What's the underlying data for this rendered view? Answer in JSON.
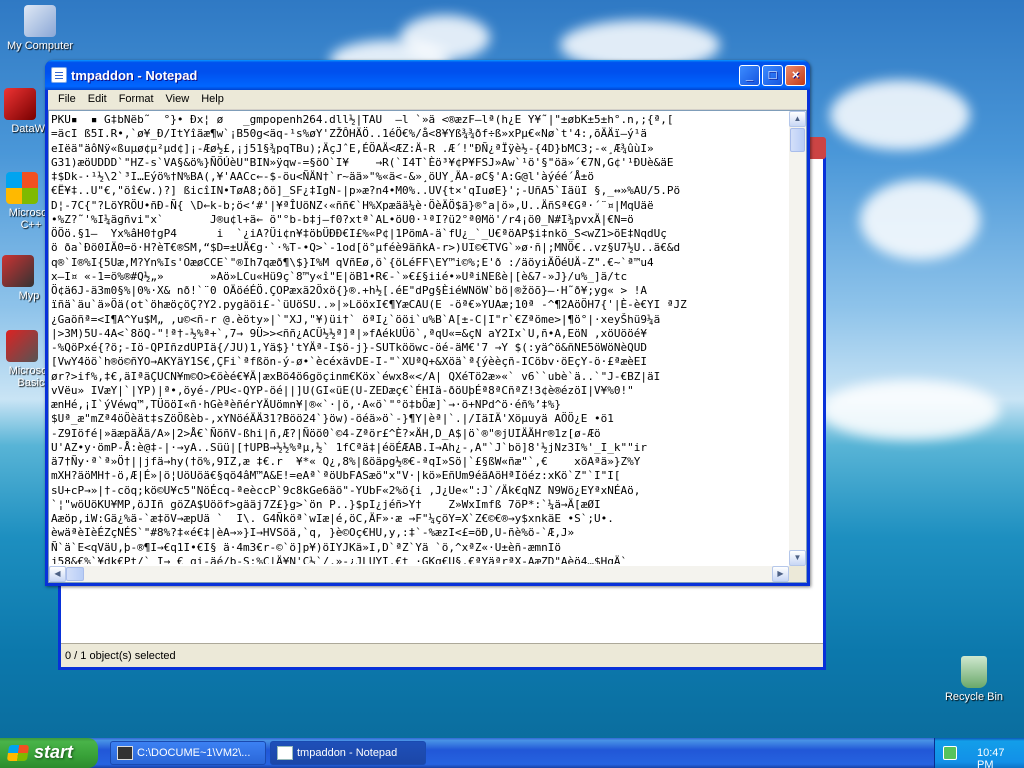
{
  "desktop": {
    "icons": [
      {
        "label": "My Computer"
      },
      {
        "label": "DataWa"
      },
      {
        "label": "Microsoft C++"
      },
      {
        "label": "Myp"
      },
      {
        "label": "Microsoft Basic"
      },
      {
        "label": "Recycle Bin"
      }
    ]
  },
  "back_window": {
    "status_text": "0 / 1 object(s) selected"
  },
  "notepad": {
    "title": "tmpaddon - Notepad",
    "menu": [
      "File",
      "Edit",
      "Format",
      "View",
      "Help"
    ],
    "content_lines": [
      "PKU▪  ▪ G‡bNëb˜  °}• Ðx¦ ø   _gmpopenh264.dll½|TAU  —l `»ä <®æzF—lª(h¿E Y¥˜|\"±øbK±5±h°.n,;{ª,[",
      "=äcI ß5I.R•,`ø¥_Ð/ItYîäæ¶w`¡B50g<äq-¹s%øY'ZŽÔHÄÖ..1éÖ€%/å<8¥Yß¾¾ðf÷ß»xPµ€«Nø`t'4:,õÄÄï—ý¹ä",
      "eIëä\"äôNÿ«ßuµø¢µ²µd¢]¡-Æø½£,¡j51§¾pqTBu);ÄçJˆE,ÉÖAÄ<ÆZ:Ä-R .Æ´!\"ÐÑ¿ªÏÿè½-{4D}bMC3;-«¸Æ¾ûùI»",
      "G31)æöUDDD`\"HZ-s`VA§&ö%}ÑÖÚèU\"BIN»ÿqw-=§öO`I¥    →R(`I4T`Èö³¥¢P¥FSJ»Aw`¹ö'§\"öä»´€7N,G¢'¹ÐUè&äE",
      "‡$Dk-·¹½\\2`³I…Eýö%†N%BA(,¥'AACc←-$-öu<ÑÄN†`r~ää»\"%«ä<-&»¸öUY¸ÄA-øC§'A:G@l'àýéé´Å±ö",
      "€Ë¥‡..U\"€,\"öî€w.)?] ßicîIN•TøA8;ðö]_SF¿‡IgN-|p»æ?n4•M0%..UV{t×'qIuøE}';-UñA5`IäüI §‚_↔»%AU/5.Pö",
      "D¦-7C{\"?LöYRÖU•ñÐ-Ñ{ \\D←k-b;ö<‘#'|¥ªÎUöNZ‹«ññ€`H%Xpæää¼è·ÖèÄÖ$ä}®°a|ö»,U..ÄñSª€Gª·´¨¤|MqUäë",
      "•%Z?˜'%I¼ägñvi\"x`       J®u¢l+ä← ö\"°b-b‡j—f0?xtª`AL•öU0·¹ªI?ü2°ª0Mö'/r4¡ö0_N#I¾pvxÄ|€N=ö",
      "ÖÖö.§1—  Yx%âH0†gP4      i  `¿iA?Üi¢n¥‡öbÜÐÐ€I£%«P¢|1PömA-ä`fU¿_`_U€ªöAP$i‡nkö_S<wZ1>öE‡NqdUç",
      "ö ða`Ðö0IÄ0=ö·H?èT€®SM,“$D=±UÄ€g·`·%T-•Q>`-1od[ö°µféè9äñkA-r>)UI©€TVG`»ø·ñ|;MNÖ€..vz§U7½U..ä€&d",
      "q®`I®%I{5Uæ‚M?Yn%Is'OæøCCE`\"®Ih7qæð¶\\$}I%M qVñEø,ö`{öLéFF\\EY™i©%;E'ð :/äöyiÄÖéUÄ-Z\".€~`ª™u4",
      "x—I¤ «-1=ö%®#Q½„»       »Aö»LCu«Hü9ç`8™y«î\"E|öB1•R€-`»€£§iié•»UªiNEßè|[è&7-»J}/u%_]ä/tc",
      "Ö¢ä6J-ä3m0§%|0%·X& nð!`¨0 OÄöéÉÖ.ÇOPæxä2Öxö{}®.+h½[.éE\"dPg§ÈiéWNöW`bö|®žöõ}—·H˜ð¥;yg« > !A",
      "ïñä`äu`ä»Öä(ot`öhæöçöÇ?Y2.pygäöi£-`üUöSU..»|»LööxI€¶YæCAU(E -öª€»YUAæ;10ª -^¶2AöÖH7{'|È-è€YI ªJZ",
      "¿Gaöñª=<I¶A^Yu$M„ ,u©<ñ-r @.èöty»|`\"XJ,\"¥)üi†` öªI¿`ööi`u%B`A[±-C|I\"r`€Zªöme>|¶ö°|·xeyŠhü9¼ä",
      "|>3M)5U-4A<`8öQ-\"!ª†-½%ª+`,7→ 9Ü>><ññ¿ACÜ½½ª]ª|»fAékUÜö`,ªqU«=&çN aY2Ix`U,ñ•A,EöN ,xöUööé¥",
      "-%QöPxé{?ö;-Iö-QPIñzdUPIä{/JU)1,Yä$}'tYÄª-I$ö-j}-SUTkööwc-öé-äM€'7 →Y $(:yä^ö&ñNE5öWöNèQUD",
      "[VwY4öö`h®ö©ñYO→AKYäY1S€,ÇFi`ªfßön-ý-ø•`ècéxävDE-I-\"`XUªQ+&Xöä`ª{ýèèçñ-ICöbv·öEçY-ö·£ªæèEI",
      "ør?>if%,‡€,äIªäÇUCN¥m©O>€öèé€¥Ä|æxBö4ö6göçinm€Köx`éwx8«</A| QXéTö2æ»«` v6``ubè`ä..`\"J-€BZ|äI",
      "vVëu» IVæY|`|YP)|ª•,öyé-/PU<-QYP-öé||]U(GI«üE(U-ZEDæç€`ÉHIä-ðöUþÉª8ªCñªZ!3¢è®ézöI|V¥%0!\"",
      "ænHé,¡I`ýVéwq™,TÜööI«ñ·hGèªèñérYÄUömn¥|®«`·|ö,·A«ö`\"°ö‡bÖæ]`→·ö+NPd^ö·éñ%’‡%}",
      "$Uª_æ\"mZª4öÖèät‡sZöÖßèb-,xYNöéÄÄ31?Böö24`}öw)-öéä»ö`-}¶Y|èª|`.|/IäIÄ'Xöµuyä AÖÖ¿E •ö1",
      "-Z9Iöfé|»äæpäÄä/A»|2>Å€`ÑöñV-ßhi|ñ,Æ?|Ñöö0`©4-Zªör£^È?×ÄH,D_A$|ö`®\"®jUIÄÄHr®1z[ø-Æö",
      "U'AZ•y·ömP-Å:è@‡-|·→yA..Süü|[†UPB→½½%ªµ,½` 1fCªä‡|éöÉÆAB.I→Ah¿-,A\"`J`bö]8'½jNz3I%'_I_k\"\"ir",
      "ä7†Ñy·ª`ª»Ö†||jfä→hy(†ö%,9IZ,æ ‡€.r  ¥*« Q¿,8%|ßöäpg½®€-ªqI»Sö|`£§ßW«ñæ\"`,€    xöAªä»}Z%Y",
      "mXH?äöMH†-ö,Æ|É»|ö¦UöUöä€§qö4âM™A&E!=eAª`ªöUbFASæö\"x\"V·|kö»EñUm9éäAöHªIöéz:xKö`Z\"`I\"I[",
      "sU+cP→»|†-cöq;kö©U¥c5\"NöÉcq-ªeèccP`9c8kGe6äö\"-YUbF«2%ö{i ,J¿Ue«\":J`/Äk€qNZ N9Wö¿EYªxNÉAö,",
      "`¦\"wöUöKU¥MP,öJIñ göZA$Uööf>gääj7Z£}g>`ön P..}$pI¿jéñ>Y†    Z»WxImfß 7öP*:`¼ä→Ä[æØI",
      "Aæöp,iW:Gä¿%ä-`æ‡öV→æpUä `  I\\. G4Ñköª`wIæ|é,öC,ÄF»·æ →F\"¼çöY=X`Z€©€®→y$xnkäE •S`;U•.",
      "èwäªèIèÉZçNÉS`\"#8%?‡«é€‡|èA→»}I→HVSöä,`q, }è©Oç€HU,y,:‡`-%æzI<£=öÐ,U-ñè%ö-`Æ,J»",
      "Ñ`ä`E<qVäU,þ-®¶I→€q1I•€I§ ä·4m3€r-©`ö]p¥)öIYJKä»I,D`ªZ`Yä `ö,^xªZ«·U±èñ-æmnIö",
      "j58&€%`¥dk€Pt/` I→_€ gi-äé/b-S:%Ç|Ä¥N'C½`/,»-¿JLUYI,€t ·GKg€U§,€ªYäªrªX-AæZD\"Aèö4…$HqÄ`",
      "ég3+=è¿`è€Xvq%J•¼æ)ÎIp-Y)ÉÖ\"8€¢9•\"äU-N,€ª•ö/ÇUöäh%M€IªaIgE)Ää>?u|ö‡I nCé·}ö+|ä«€çä",
      "K `gr‡<S~`ä™€O-í10 .|>y »E2'•Fwrb4ö‡f»xüUI\"-A«kñ†-n.är} ,öh~t`}ÇF€YüIöI.N«[-`«~U†y1ø II"
    ]
  },
  "taskbar": {
    "start_label": "start",
    "tasks": [
      {
        "label": "C:\\DOCUME~1\\VM2\\..."
      },
      {
        "label": "tmpaddon - Notepad"
      }
    ],
    "clock": "10:47 PM"
  }
}
